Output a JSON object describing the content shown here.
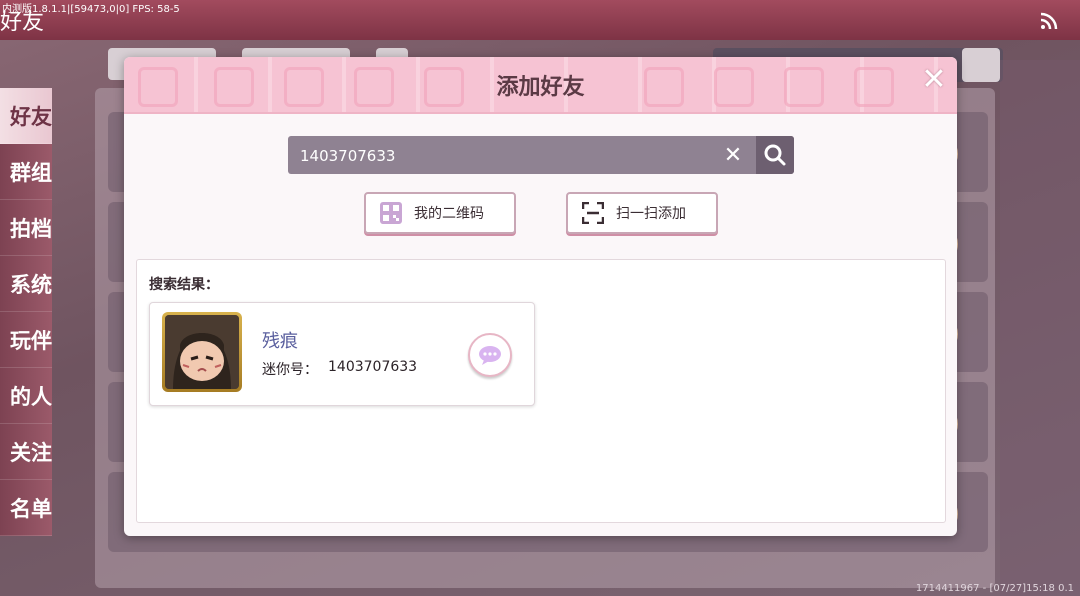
{
  "debug": "内测版1.8.1.1|[59473,0|0] FPS: 58-5",
  "app": {
    "title": "好友",
    "footer": "1714411967 - [07/27]15:18 0.1"
  },
  "sidebar": {
    "items": [
      {
        "label": "好友"
      },
      {
        "label": "群组"
      },
      {
        "label": "拍档"
      },
      {
        "label": "系统"
      },
      {
        "label": "玩伴"
      },
      {
        "label": "的人"
      },
      {
        "label": "关注"
      },
      {
        "label": "名单"
      }
    ]
  },
  "modal": {
    "title": "添加好友",
    "search": {
      "value": "1403707633"
    },
    "buttons": {
      "my_qr": "我的二维码",
      "scan_add": "扫一扫添加"
    },
    "results_label": "搜索结果：",
    "result": {
      "nickname": "残痕",
      "uid_label": "迷你号：",
      "uid_value": "1403707633"
    }
  },
  "colors": {
    "accent_pink": "#f6c3d3",
    "title_text": "#5b3a45",
    "nickname": "#5a5f9e"
  },
  "icons": [
    "rss-icon",
    "close-icon",
    "clear-icon",
    "search-icon",
    "qr-code-icon",
    "scan-icon",
    "chat-bubble-icon"
  ]
}
